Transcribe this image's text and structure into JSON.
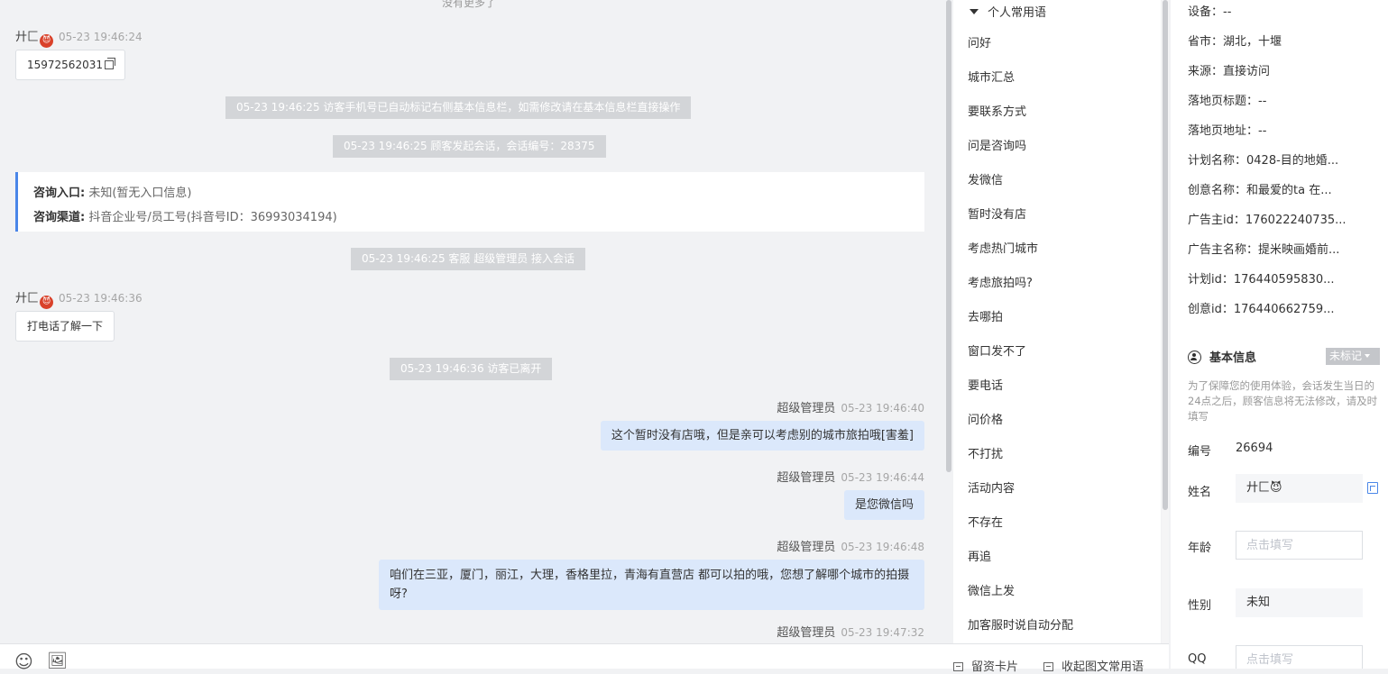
{
  "chat": {
    "more_history": "没有更多了",
    "messages": [
      {
        "visitor_name": "廾匚",
        "visitor_emoji": "😈",
        "time": "05-23 19:46:24",
        "text": "15972562031"
      },
      {
        "system": "05-23 19:46:25 访客手机号已自动标记右侧基本信息栏，如需修改请在基本信息栏直接操作"
      },
      {
        "system": "05-23 19:46:25 顾客发起会话，会话编号：28375"
      },
      {
        "system": "05-23 19:46:25 客服 超级管理员 接入会话"
      },
      {
        "visitor_name": "廾匚",
        "visitor_emoji": "😈",
        "time": "05-23 19:46:36",
        "text": "打电话了解一下"
      },
      {
        "system": "05-23 19:46:36 访客已离开"
      },
      {
        "agent": "超级管理员",
        "time": "05-23 19:46:40",
        "text": "这个暂时没有店哦，但是亲可以考虑别的城市旅拍哦[害羞]"
      },
      {
        "agent": "超级管理员",
        "time": "05-23 19:46:44",
        "text": "是您微信吗"
      },
      {
        "agent": "超级管理员",
        "time": "05-23 19:46:48",
        "text": "咱们在三亚，厦门，丽江，大理，香格里拉，青海有直营店 都可以拍的哦，您想了解哪个城市的拍摄呀?"
      },
      {
        "agent": "超级管理员",
        "time": "05-23 19:47:32"
      }
    ],
    "entry_card": {
      "entry_label": "咨询入口:",
      "entry_value": "未知(暂无入口信息)",
      "channel_label": "咨询渠道:",
      "channel_value": "抖音企业号/员工号(抖音号ID：36993034194)"
    }
  },
  "toolbar": {
    "emoji_icon": "☺",
    "image_icon": "🖼",
    "info_card_label": "留资卡片",
    "collapse_phrases_label": "收起图文常用语"
  },
  "phrases": {
    "header": "个人常用语",
    "items": [
      "问好",
      "城市汇总",
      "要联系方式",
      "问是咨询吗",
      "发微信",
      "暂时没有店",
      "考虑热门城市",
      "考虑旅拍吗?",
      "去哪拍",
      "窗口发不了",
      "要电话",
      "问价格",
      "不打扰",
      "活动内容",
      "不存在",
      "再追",
      "微信上发",
      "加客服时说自动分配"
    ]
  },
  "visitor": {
    "meta": [
      "设备：--",
      "省市：湖北，十堰",
      "来源：直接访问",
      "落地页标题：--",
      "落地页地址：--",
      "计划名称：0428-目的地婚...",
      "创意名称：和最爱的ta 在...",
      "广告主id：176022240735...",
      "广告主名称：提米映画婚前...",
      "计划id：176440595830...",
      "创意id：176440662759..."
    ],
    "basic_info": {
      "title": "基本信息",
      "mark_status": "未标记",
      "notice": "为了保障您的使用体验，会话发生当日的24点之后，顾客信息将无法修改，请及时填写",
      "id_label": "编号",
      "id_value": "26694",
      "name_label": "姓名",
      "name_value": "廾匚😈",
      "age_label": "年龄",
      "age_placeholder": "点击填写",
      "gender_label": "性别",
      "gender_value": "未知",
      "qq_label": "QQ",
      "qq_placeholder": "点击填写"
    }
  }
}
